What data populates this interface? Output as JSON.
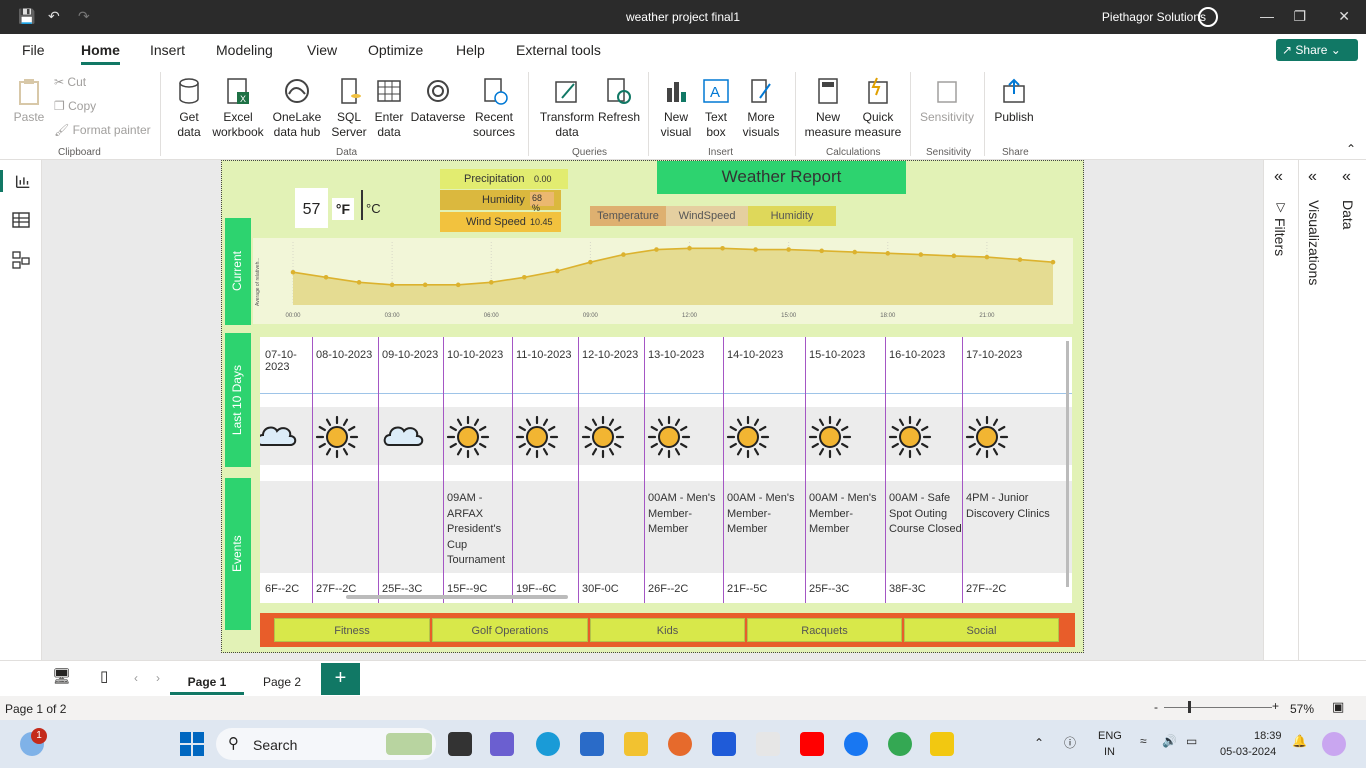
{
  "window": {
    "title": "weather project final1",
    "user": "Piethagor Solutions"
  },
  "menu": {
    "items": [
      "File",
      "Home",
      "Insert",
      "Modeling",
      "View",
      "Optimize",
      "Help",
      "External tools"
    ],
    "active": "Home",
    "share": "Share"
  },
  "ribbon": {
    "clipboard": {
      "paste": "Paste",
      "cut": "Cut",
      "copy": "Copy",
      "format_painter": "Format painter",
      "group": "Clipboard"
    },
    "data": {
      "get_data": "Get data",
      "excel": "Excel workbook",
      "onelake": "OneLake data hub",
      "sql": "SQL Server",
      "enter_data": "Enter data",
      "dataverse": "Dataverse",
      "recent": "Recent sources",
      "group": "Data"
    },
    "queries": {
      "transform": "Transform data",
      "refresh": "Refresh",
      "group": "Queries"
    },
    "insert": {
      "new_visual": "New visual",
      "text_box": "Text box",
      "more_visuals": "More visuals",
      "group": "Insert"
    },
    "calculations": {
      "new_measure": "New measure",
      "quick_measure": "Quick measure",
      "group": "Calculations"
    },
    "sensitivity": {
      "label": "Sensitivity",
      "group": "Sensitivity"
    },
    "share": {
      "publish": "Publish",
      "group": "Share"
    }
  },
  "report": {
    "title": "Weather Report",
    "temperature": "57",
    "unit_f": "°F",
    "unit_c": "°C",
    "stats": [
      {
        "label": "Precipitation",
        "value": "0.00"
      },
      {
        "label": "Humidity",
        "value": "68 %"
      },
      {
        "label": "Wind Speed",
        "value": "10.45"
      }
    ],
    "legend": [
      "Temperature",
      "WindSpeed",
      "Humidity"
    ],
    "side_tabs": {
      "current": "Current",
      "last10": "Last 10 Days",
      "events": "Events"
    },
    "categories": [
      "Fitness",
      "Golf Operations",
      "Kids",
      "Racquets",
      "Social"
    ]
  },
  "chart_data": {
    "type": "area",
    "ylabel": "Average of relativeh...",
    "x_ticks": [
      "00:00",
      "03:00",
      "06:00",
      "09:00",
      "12:00",
      "15:00",
      "18:00",
      "21:00"
    ],
    "x": [
      "00:00",
      "01:00",
      "02:00",
      "03:00",
      "04:00",
      "05:00",
      "06:00",
      "07:00",
      "08:00",
      "09:00",
      "10:00",
      "11:00",
      "12:00",
      "13:00",
      "14:00",
      "15:00",
      "16:00",
      "17:00",
      "18:00",
      "19:00",
      "20:00",
      "21:00",
      "22:00",
      "23:00"
    ],
    "values": [
      76,
      72,
      68,
      66,
      66,
      66,
      68,
      72,
      77,
      84,
      90,
      94,
      95,
      95,
      94,
      94,
      93,
      92,
      91,
      90,
      89,
      88,
      86,
      84
    ],
    "ylim": [
      50,
      100
    ]
  },
  "days": [
    {
      "date": "07-10-2023",
      "icon": "cloud-icon",
      "event": "",
      "temp": "6F--2C"
    },
    {
      "date": "08-10-2023",
      "icon": "sun-icon",
      "event": "",
      "temp": "27F--2C"
    },
    {
      "date": "09-10-2023",
      "icon": "cloud-icon",
      "event": "",
      "temp": "25F--3C"
    },
    {
      "date": "10-10-2023",
      "icon": "sun-icon",
      "event": "09AM - ARFAX President's Cup Tournament",
      "temp": "15F--9C"
    },
    {
      "date": "11-10-2023",
      "icon": "sun-icon",
      "event": "",
      "temp": "19F--6C"
    },
    {
      "date": "12-10-2023",
      "icon": "sun-icon",
      "event": "",
      "temp": "30F-0C"
    },
    {
      "date": "13-10-2023",
      "icon": "sun-icon",
      "event": "00AM - Men's Member-Member",
      "temp": "26F--2C"
    },
    {
      "date": "14-10-2023",
      "icon": "sun-icon",
      "event": "00AM - Men's Member-Member",
      "temp": "21F--5C"
    },
    {
      "date": "15-10-2023",
      "icon": "sun-icon",
      "event": "00AM - Men's Member-Member",
      "temp": "25F--3C"
    },
    {
      "date": "16-10-2023",
      "icon": "sun-icon",
      "event": "00AM - Safe Spot Outing Course Closed",
      "temp": "38F-3C"
    },
    {
      "date": "17-10-2023",
      "icon": "sun-icon",
      "event": "4PM - Junior Discovery Clinics",
      "temp": "27F--2C"
    }
  ],
  "panes": {
    "filters": "Filters",
    "visualizations": "Visualizations",
    "data": "Data"
  },
  "pages": {
    "tabs": [
      "Page 1",
      "Page 2"
    ],
    "active": "Page 1",
    "add": "+"
  },
  "status": {
    "page": "Page 1 of 2",
    "zoom": "57%"
  },
  "taskbar": {
    "search": "Search",
    "lang1": "ENG",
    "lang2": "IN",
    "time": "18:39",
    "date": "05-03-2024",
    "badge": "1"
  }
}
